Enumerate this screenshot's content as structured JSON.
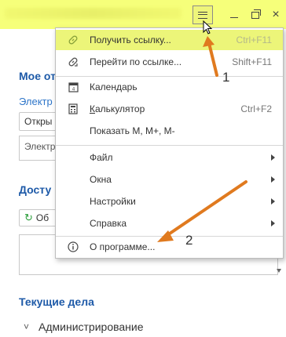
{
  "window": {
    "menu_button_label": "≡",
    "close_label": "×"
  },
  "background": {
    "section1_title": "Мое от",
    "link_text": "Электр",
    "open_button": "Откры",
    "field_text": "Электр",
    "section2_title": "Досту",
    "refresh_button": "Об",
    "tasks_title": "Текущие дела",
    "tasks_item": "Администрирование"
  },
  "menu": {
    "items": [
      {
        "label": "Получить ссылку...",
        "shortcut": "Ctrl+F11",
        "icon": "link-icon",
        "highlighted": true
      },
      {
        "label": "Перейти по ссылке...",
        "shortcut": "Shift+F11",
        "icon": "follow-link-icon"
      },
      {
        "label": "Календарь",
        "shortcut": "",
        "icon": "calendar-icon"
      },
      {
        "label": "Калькулятор",
        "shortcut": "Ctrl+F2",
        "icon": "calculator-icon"
      },
      {
        "label": "Показать M, M+, M-",
        "shortcut": ""
      },
      {
        "label": "Файл",
        "submenu": true
      },
      {
        "label": "Окна",
        "submenu": true
      },
      {
        "label": "Настройки",
        "submenu": true
      },
      {
        "label": "Справка",
        "submenu": true
      },
      {
        "label": "О программе...",
        "shortcut": "",
        "icon": "info-icon"
      }
    ]
  },
  "annotations": {
    "marker_1": "1",
    "marker_2": "2",
    "arrow_color": "#e07a1f"
  },
  "colors": {
    "titlebar": "#f6ff7a",
    "highlight": "#ecf579",
    "section_blue": "#1e5aa8"
  }
}
